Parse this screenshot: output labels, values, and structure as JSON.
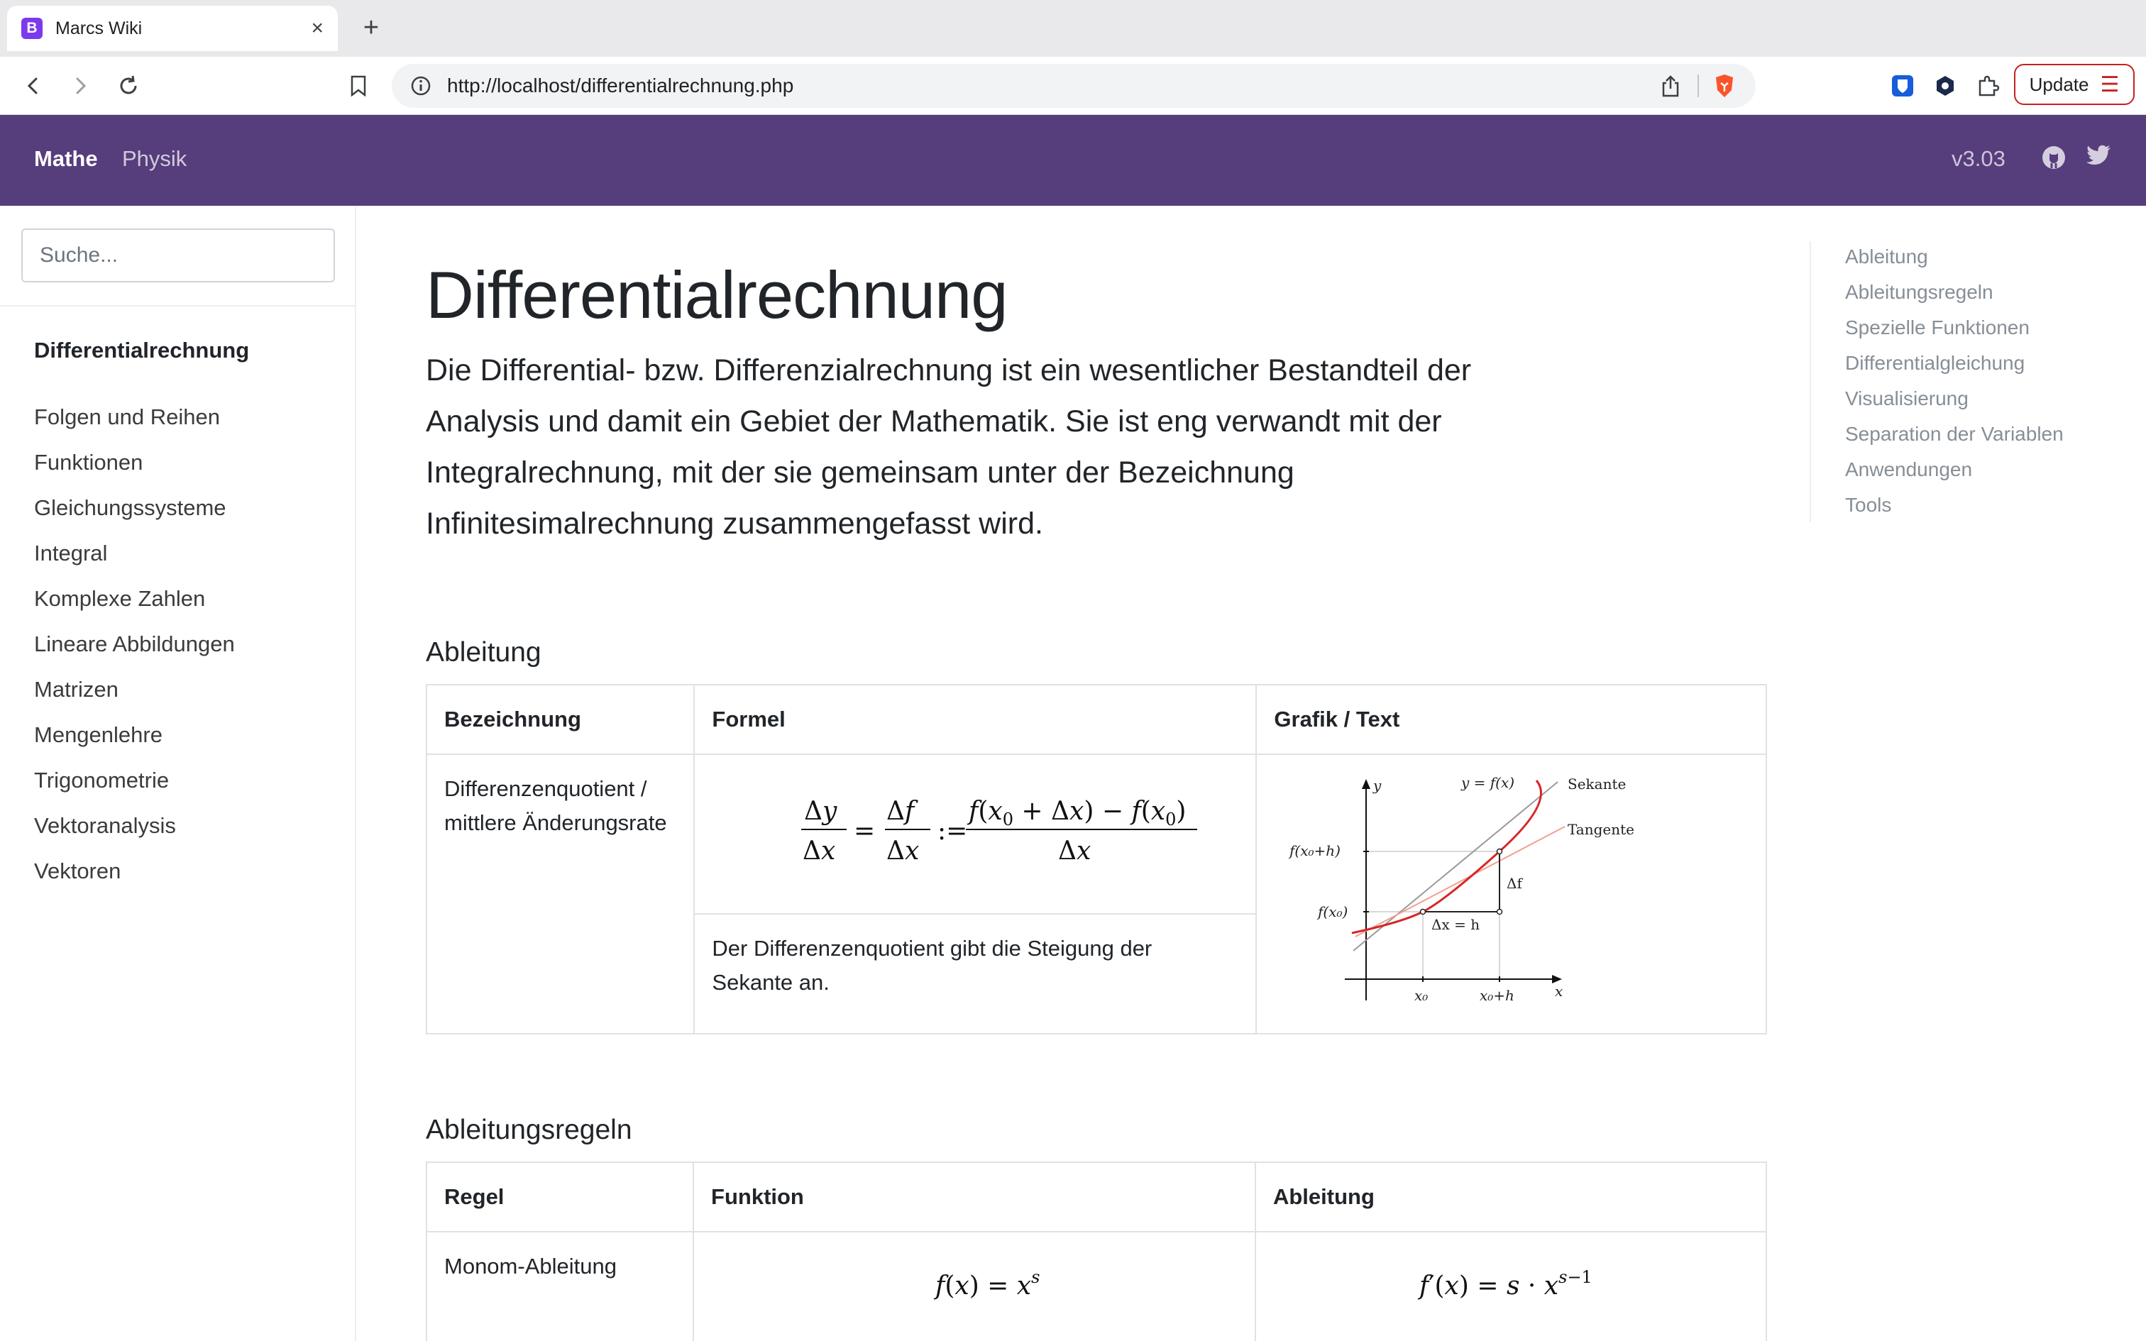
{
  "browser": {
    "tab_title": "Marcs Wiki",
    "favicon_letter": "B",
    "url": "http://localhost/differentialrechnung.php",
    "update_label": "Update"
  },
  "navbar": {
    "links": [
      "Mathe",
      "Physik"
    ],
    "version": "v3.03"
  },
  "sidebar": {
    "search_placeholder": "Suche...",
    "active": "Differentialrechnung",
    "items": [
      "Folgen und Reihen",
      "Funktionen",
      "Gleichungssysteme",
      "Integral",
      "Komplexe Zahlen",
      "Lineare Abbildungen",
      "Matrizen",
      "Mengenlehre",
      "Trigonometrie",
      "Vektoranalysis",
      "Vektoren"
    ]
  },
  "main": {
    "title": "Differentialrechnung",
    "lead": "Die Differential- bzw. Differenzialrechnung ist ein wesentlicher Bestandteil der Analysis und damit ein Gebiet der Mathematik. Sie ist eng verwandt mit der Integralrechnung, mit der sie gemeinsam unter der Bezeichnung Infinitesimalrechnung zusammengefasst wird.",
    "sections": [
      {
        "title": "Ableitung",
        "headers": [
          "Bezeichnung",
          "Formel",
          "Grafik / Text"
        ],
        "row": {
          "name": "Differenzenquotient / mittlere Änderungsrate",
          "text": "Der Differenzenquotient gibt die Steigung der Sekante an."
        },
        "figure": {
          "labels": {
            "y_axis": "y",
            "x_axis": "x",
            "curve": "y = f(x)",
            "secant": "Sekante",
            "tangent": "Tangente",
            "fxh": "f(x₀+h)",
            "fx": "f(x₀)",
            "df": "Δf",
            "dx": "Δx = h",
            "x0": "x₀",
            "x0h": "x₀+h"
          },
          "colors": {
            "curve": "#d62728",
            "tangent": "#f0a090",
            "secant": "#999999"
          }
        }
      },
      {
        "title": "Ableitungsregeln",
        "headers": [
          "Regel",
          "Funktion",
          "Ableitung"
        ],
        "row": {
          "name": "Monom-Ableitung"
        }
      }
    ]
  },
  "toc": [
    "Ableitung",
    "Ableitungsregeln",
    "Spezielle Funktionen",
    "Differentialgleichung",
    "Visualisierung",
    "Separation der Variablen",
    "Anwendungen",
    "Tools"
  ]
}
